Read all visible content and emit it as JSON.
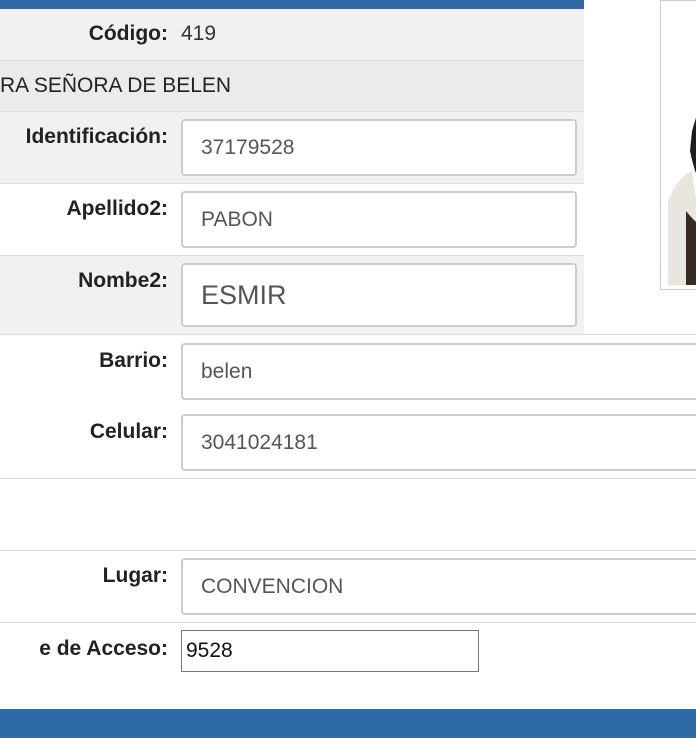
{
  "form": {
    "codigo_label": "Código:",
    "codigo_value": "419",
    "institution_name": "RA SEÑORA DE BELEN",
    "identificacion_label": "Identificación:",
    "identificacion_value": "37179528",
    "apellido2_label": "Apellido2:",
    "apellido2_value": "PABON",
    "nombre2_label": "Nombe2:",
    "nombre2_value": "ESMIR",
    "barrio_label": "Barrio:",
    "barrio_value": "belen",
    "celular_label": "Celular:",
    "celular_value": "3041024181",
    "lugar_label": "Lugar:",
    "lugar_value": "CONVENCION",
    "clave_label": "e de Acceso:",
    "clave_value": "9528"
  },
  "colors": {
    "header_bar": "#2e6aa5",
    "row_shade": "#f1f1f1"
  }
}
